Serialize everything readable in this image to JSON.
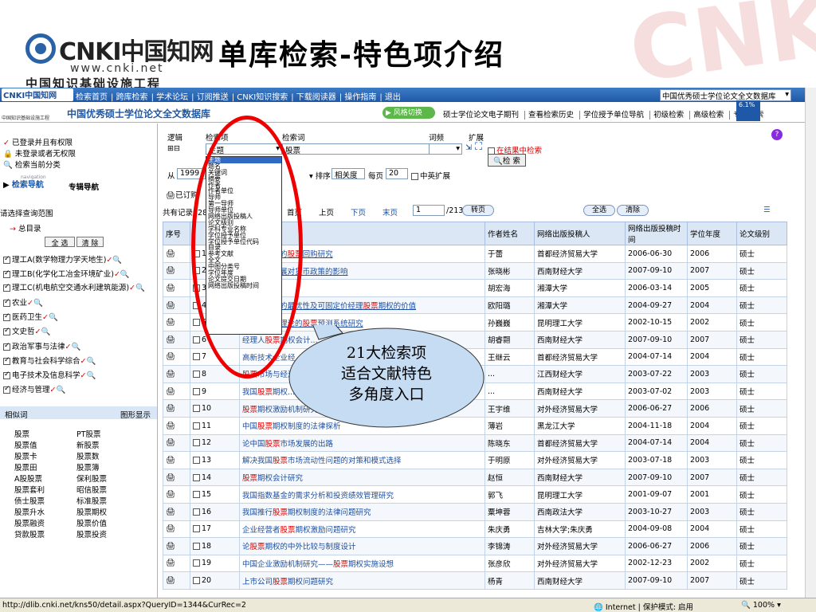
{
  "slide": {
    "title": "单库检索-特色项介绍",
    "logo_text": "CNKI中国知网",
    "logo_url": "www.cnki.net",
    "logo_sub": "中国知识基础设施工程"
  },
  "nav": {
    "logo": "CNKI中国知网",
    "links": [
      "检索首页",
      "跨库检索",
      "学术论坛",
      "订阅推送",
      "CNKI知识搜索",
      "下载阅读器",
      "操作指南",
      "退出"
    ],
    "db_select": "中国优秀硕士学位论文全文数据库"
  },
  "titlebar": {
    "small_logo": "中国知识基础设施工程",
    "db_title": "中国优秀硕士学位论文全文数据库",
    "style_btn": "风格切换",
    "links": [
      "硕士学位论文电子期刊",
      "查看检索历史",
      "学位授予单位导航",
      "初级检索",
      "高级检索",
      "专业检索"
    ],
    "pct": "6.1%"
  },
  "left": {
    "login1": "已登录并且有权限",
    "login2": "未登录或者无权限",
    "cur": "检索当前分类",
    "nav_label": "检索导航",
    "nav_sub": "navigation",
    "nav_tab2": "专辑导航",
    "scope": "请选择查询范围",
    "root": "总目录",
    "all_btn": "全 选",
    "clear_btn": "清 除",
    "cats": [
      "理工A(数学物理力学天地生)",
      "理工B(化学化工冶金环境矿业)",
      "理工C(机电航空交通水利建筑能源)",
      "农业",
      "医药卫生",
      "文史哲",
      "政治军事与法律",
      "教育与社会科学综合",
      "电子技术及信息科学",
      "经济与管理"
    ],
    "related_label": "相似词",
    "graph_label": "图形显示",
    "related_words": [
      "股票",
      "PT股票",
      "股票值",
      "新股票",
      "股票卡",
      "股票数",
      "股票田",
      "股票簿",
      "A股股票",
      "保利股票",
      "股票套利",
      "昭信股票",
      "债士股票",
      "标准股票",
      "股票升水",
      "股票期权",
      "股票融资",
      "股票价值",
      "贷款股票",
      "股票投资"
    ]
  },
  "search": {
    "logic_label": "逻辑",
    "field_label": "检索项",
    "term_label": "检索词",
    "freq_label": "词频",
    "expand_label": "扩展",
    "field_value": "主题",
    "term_value": "股票",
    "from_label": "从",
    "year": "1999",
    "in_results": "在结果中检索",
    "search_btn": "检 索",
    "sort_label": "排序",
    "sort_value": "相关度",
    "per_page_label": "每页",
    "per_page": "20",
    "cn_expand": "中英扩展",
    "selected": "已订购",
    "summary": "共有记录428条",
    "dropdown": [
      "主题",
      "题名",
      "关键词",
      "摘要",
      "作者",
      "作者单位",
      "导师",
      "第一导师",
      "导师单位",
      "网络出版投稿人",
      "论文级别",
      "学科专业名称",
      "学位授予单位",
      "学位授予单位代码",
      "目录",
      "参考文献",
      "全文",
      "中图分类号",
      "学位年度",
      "论文提交日期",
      "网络出版投稿时间"
    ],
    "pager": {
      "first": "首页",
      "prev": "上页",
      "next": "下页",
      "last": "末页",
      "page": "1",
      "total": "/213",
      "go": "转页",
      "all": "全选",
      "clear": "清除"
    }
  },
  "table": {
    "headers": [
      "序号",
      "题名",
      "作者姓名",
      "网络出版投稿人",
      "网络出版投稿时间",
      "学位年度",
      "论文级别"
    ],
    "rows": [
      [
        "1",
        "...期权定价的股票回购研究",
        "于蕾",
        "首都经济贸易大学",
        "2006-06-30",
        "2006",
        "硕士"
      ],
      [
        "2",
        "...市场的发展对货币政策的影响",
        "张晓彬",
        "西南财经大学",
        "2007-09-10",
        "2007",
        "硕士"
      ],
      [
        "3",
        "...经济增长",
        "胡宏海",
        "湘潭大学",
        "2006-03-14",
        "2005",
        "硕士"
      ],
      [
        "4",
        "...权固定价的最优性及可固定价经理股票期权的价值",
        "欧阳璐",
        "湘潭大学",
        "2004-09-27",
        "2004",
        "硕士"
      ],
      [
        "5",
        "...神经网络理论的股票预测系统研究",
        "孙巍巍",
        "昆明理工大学",
        "2002-10-15",
        "2002",
        "硕士"
      ],
      [
        "6",
        "经理人股票期权会计...",
        "胡睿翾",
        "西南财经大学",
        "2007-09-10",
        "2007",
        "硕士"
      ],
      [
        "7",
        "高新技术企业经...",
        "王继云",
        "首都经济贸易大学",
        "2004-07-14",
        "2004",
        "硕士"
      ],
      [
        "8",
        "股票市场与经济...",
        "...",
        "江西财经大学",
        "2003-07-22",
        "2003",
        "硕士"
      ],
      [
        "9",
        "我国股票期权...",
        "...",
        "西南财经大学",
        "2003-07-02",
        "2003",
        "硕士"
      ],
      [
        "10",
        "股票期权激励机制研究",
        "王宇维",
        "对外经济贸易大学",
        "2006-06-27",
        "2006",
        "硕士"
      ],
      [
        "11",
        "中国股票期权制度的法律探析",
        "薄岩",
        "黑龙江大学",
        "2004-11-18",
        "2004",
        "硕士"
      ],
      [
        "12",
        "论中国股票市场发展的出路",
        "陈晓东",
        "首都经济贸易大学",
        "2004-07-14",
        "2004",
        "硕士"
      ],
      [
        "13",
        "解决我国股票市场流动性问题的对策和模式选择",
        "于明原",
        "对外经济贸易大学",
        "2003-07-18",
        "2003",
        "硕士"
      ],
      [
        "14",
        "股票期权会计研究",
        "赵恒",
        "西南财经大学",
        "2007-09-10",
        "2007",
        "硕士"
      ],
      [
        "15",
        "我国指数基金的需求分析和投资绩效管理研究",
        "郭飞",
        "昆明理工大学",
        "2001-09-07",
        "2001",
        "硕士"
      ],
      [
        "16",
        "我国推行股票期权制度的法律问题研究",
        "粟坤蓉",
        "西南政法大学",
        "2003-10-27",
        "2003",
        "硕士"
      ],
      [
        "17",
        "企业经营者股票期权激励问题研究",
        "朱庆勇",
        "吉林大学;朱庆勇",
        "2004-09-08",
        "2004",
        "硕士"
      ],
      [
        "18",
        "论股票期权的中外比较与制度设计",
        "李锦涛",
        "对外经济贸易大学",
        "2006-06-27",
        "2006",
        "硕士"
      ],
      [
        "19",
        "中国企业激励机制研究——股票期权实施设想",
        "张彦欣",
        "对外经济贸易大学",
        "2002-12-23",
        "2002",
        "硕士"
      ],
      [
        "20",
        "上市公司股票期权问题研究",
        "杨青",
        "西南财经大学",
        "2007-09-10",
        "2007",
        "硕士"
      ]
    ]
  },
  "callout": {
    "line1": "21大检索项",
    "line2": "适合文献特色",
    "line3": "多角度入口"
  },
  "status": {
    "url": "http://dlib.cnki.net/kns50/detail.aspx?QueryID=1344&CurRec=2",
    "zone": "Internet | 保护模式: 启用",
    "zoom": "100%"
  },
  "colors": {
    "nav": "#1e58a6",
    "accent_red": "#e00000",
    "keyword": "#dd0000"
  }
}
